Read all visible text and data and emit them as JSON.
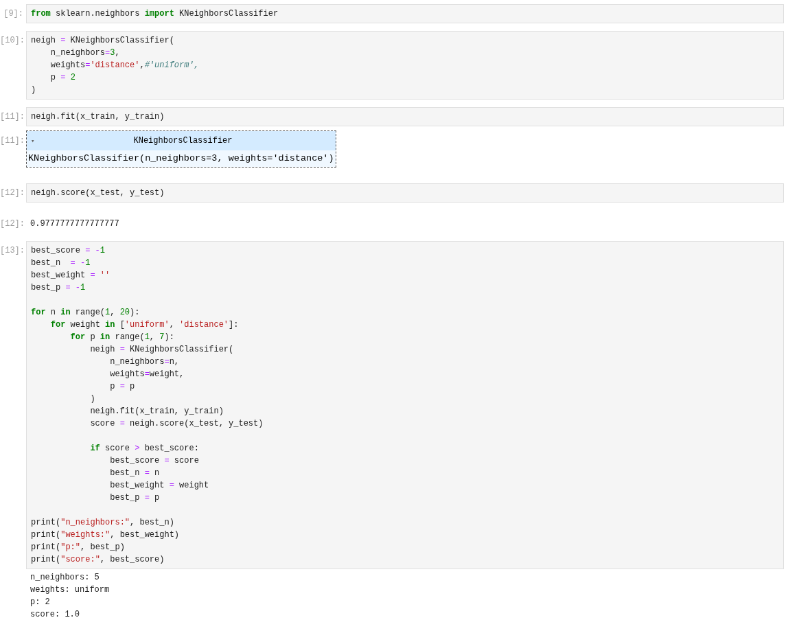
{
  "cells": [
    {
      "kind": "code",
      "prompt": "[9]:",
      "blocks": [
        [
          [
            {
              "text": "from",
              "kind": "kw"
            },
            {
              "text": " sklearn.neighbors ",
              "kind": "n"
            },
            {
              "text": "import",
              "kind": "kw"
            },
            {
              "text": " KNeighborsClassifier",
              "kind": "n"
            }
          ]
        ]
      ]
    },
    {
      "kind": "code",
      "prompt": "[10]:",
      "blocks": [
        [
          [
            {
              "text": "neigh ",
              "kind": "n"
            },
            {
              "text": "=",
              "kind": "op"
            },
            {
              "text": " KNeighborsClassifier(",
              "kind": "n"
            }
          ],
          [
            {
              "text": "    n_neighbors",
              "kind": "n"
            },
            {
              "text": "=",
              "kind": "op"
            },
            {
              "text": "3",
              "kind": "num"
            },
            {
              "text": ",",
              "kind": "n"
            }
          ],
          [
            {
              "text": "    weights",
              "kind": "n"
            },
            {
              "text": "=",
              "kind": "op"
            },
            {
              "text": "'distance'",
              "kind": "str"
            },
            {
              "text": ",",
              "kind": "n"
            },
            {
              "text": "#'uniform',",
              "kind": "com"
            }
          ],
          [
            {
              "text": "    p ",
              "kind": "n"
            },
            {
              "text": "= ",
              "kind": "op"
            },
            {
              "text": "2",
              "kind": "num"
            }
          ],
          [
            {
              "text": ")",
              "kind": "n"
            }
          ]
        ]
      ]
    },
    {
      "kind": "code",
      "prompt": "[11]:",
      "blocks": [
        [
          [
            {
              "text": "neigh.fit(x_train, y_train)",
              "kind": "n"
            }
          ]
        ]
      ]
    },
    {
      "kind": "estimator",
      "prompt": "[11]:",
      "toggle": "▾",
      "title": "KNeighborsClassifier",
      "repr": "KNeighborsClassifier(n_neighbors=3, weights='distance')"
    },
    {
      "kind": "code",
      "prompt": "[12]:",
      "blocks": [
        [
          [
            {
              "text": "neigh.score(x_test, y_test)",
              "kind": "n"
            }
          ]
        ]
      ]
    },
    {
      "kind": "result",
      "prompt": "[12]:",
      "lines": [
        "0.9777777777777777"
      ]
    },
    {
      "kind": "code",
      "prompt": "[13]:",
      "blocks": [
        [
          [
            {
              "text": "best_score ",
              "kind": "n"
            },
            {
              "text": "= -",
              "kind": "op"
            },
            {
              "text": "1",
              "kind": "num"
            }
          ],
          [
            {
              "text": "best_n  ",
              "kind": "n"
            },
            {
              "text": "= -",
              "kind": "op"
            },
            {
              "text": "1",
              "kind": "num"
            }
          ],
          [
            {
              "text": "best_weight ",
              "kind": "n"
            },
            {
              "text": "= ",
              "kind": "op"
            },
            {
              "text": "''",
              "kind": "str"
            }
          ],
          [
            {
              "text": "best_p ",
              "kind": "n"
            },
            {
              "text": "= -",
              "kind": "op"
            },
            {
              "text": "1",
              "kind": "num"
            }
          ]
        ],
        [
          [
            {
              "text": "for",
              "kind": "kw"
            },
            {
              "text": " n ",
              "kind": "n"
            },
            {
              "text": "in",
              "kind": "kw"
            },
            {
              "text": " range(",
              "kind": "n"
            },
            {
              "text": "1",
              "kind": "num"
            },
            {
              "text": ", ",
              "kind": "n"
            },
            {
              "text": "20",
              "kind": "num"
            },
            {
              "text": "):",
              "kind": "n"
            }
          ],
          [
            {
              "text": "    for",
              "kind": "kw"
            },
            {
              "text": " weight ",
              "kind": "n"
            },
            {
              "text": "in",
              "kind": "kw"
            },
            {
              "text": " [",
              "kind": "n"
            },
            {
              "text": "'uniform'",
              "kind": "str"
            },
            {
              "text": ", ",
              "kind": "n"
            },
            {
              "text": "'distance'",
              "kind": "str"
            },
            {
              "text": "]:",
              "kind": "n"
            }
          ],
          [
            {
              "text": "        for",
              "kind": "kw"
            },
            {
              "text": " p ",
              "kind": "n"
            },
            {
              "text": "in",
              "kind": "kw"
            },
            {
              "text": " range(",
              "kind": "n"
            },
            {
              "text": "1",
              "kind": "num"
            },
            {
              "text": ", ",
              "kind": "n"
            },
            {
              "text": "7",
              "kind": "num"
            },
            {
              "text": "):",
              "kind": "n"
            }
          ],
          [
            {
              "text": "            neigh ",
              "kind": "n"
            },
            {
              "text": "=",
              "kind": "op"
            },
            {
              "text": " KNeighborsClassifier(",
              "kind": "n"
            }
          ],
          [
            {
              "text": "                n_neighbors",
              "kind": "n"
            },
            {
              "text": "=",
              "kind": "op"
            },
            {
              "text": "n,",
              "kind": "n"
            }
          ],
          [
            {
              "text": "                weights",
              "kind": "n"
            },
            {
              "text": "=",
              "kind": "op"
            },
            {
              "text": "weight,",
              "kind": "n"
            }
          ],
          [
            {
              "text": "                p ",
              "kind": "n"
            },
            {
              "text": "=",
              "kind": "op"
            },
            {
              "text": " p",
              "kind": "n"
            }
          ],
          [
            {
              "text": "            )",
              "kind": "n"
            }
          ],
          [
            {
              "text": "            neigh.fit(x_train, y_train)",
              "kind": "n"
            }
          ],
          [
            {
              "text": "            score ",
              "kind": "n"
            },
            {
              "text": "=",
              "kind": "op"
            },
            {
              "text": " neigh.score(x_test, y_test)",
              "kind": "n"
            }
          ]
        ],
        [
          [
            {
              "text": "            if",
              "kind": "kw"
            },
            {
              "text": " score ",
              "kind": "n"
            },
            {
              "text": ">",
              "kind": "op"
            },
            {
              "text": " best_score:",
              "kind": "n"
            }
          ],
          [
            {
              "text": "                best_score ",
              "kind": "n"
            },
            {
              "text": "=",
              "kind": "op"
            },
            {
              "text": " score",
              "kind": "n"
            }
          ],
          [
            {
              "text": "                best_n ",
              "kind": "n"
            },
            {
              "text": "=",
              "kind": "op"
            },
            {
              "text": " n",
              "kind": "n"
            }
          ],
          [
            {
              "text": "                best_weight ",
              "kind": "n"
            },
            {
              "text": "=",
              "kind": "op"
            },
            {
              "text": " weight",
              "kind": "n"
            }
          ],
          [
            {
              "text": "                best_p ",
              "kind": "n"
            },
            {
              "text": "=",
              "kind": "op"
            },
            {
              "text": " p",
              "kind": "n"
            }
          ]
        ],
        [
          [
            {
              "text": "print(",
              "kind": "n"
            },
            {
              "text": "\"n_neighbors:\"",
              "kind": "str"
            },
            {
              "text": ", best_n)",
              "kind": "n"
            }
          ],
          [
            {
              "text": "print(",
              "kind": "n"
            },
            {
              "text": "\"weights:\"",
              "kind": "str"
            },
            {
              "text": ", best_weight)",
              "kind": "n"
            }
          ],
          [
            {
              "text": "print(",
              "kind": "n"
            },
            {
              "text": "\"p:\"",
              "kind": "str"
            },
            {
              "text": ", best_p)",
              "kind": "n"
            }
          ],
          [
            {
              "text": "print(",
              "kind": "n"
            },
            {
              "text": "\"score:\"",
              "kind": "str"
            },
            {
              "text": ", best_score)",
              "kind": "n"
            }
          ]
        ]
      ]
    },
    {
      "kind": "stream",
      "lines": [
        "n_neighbors: 5",
        "weights: uniform",
        "p: 2",
        "score: 1.0"
      ]
    }
  ]
}
